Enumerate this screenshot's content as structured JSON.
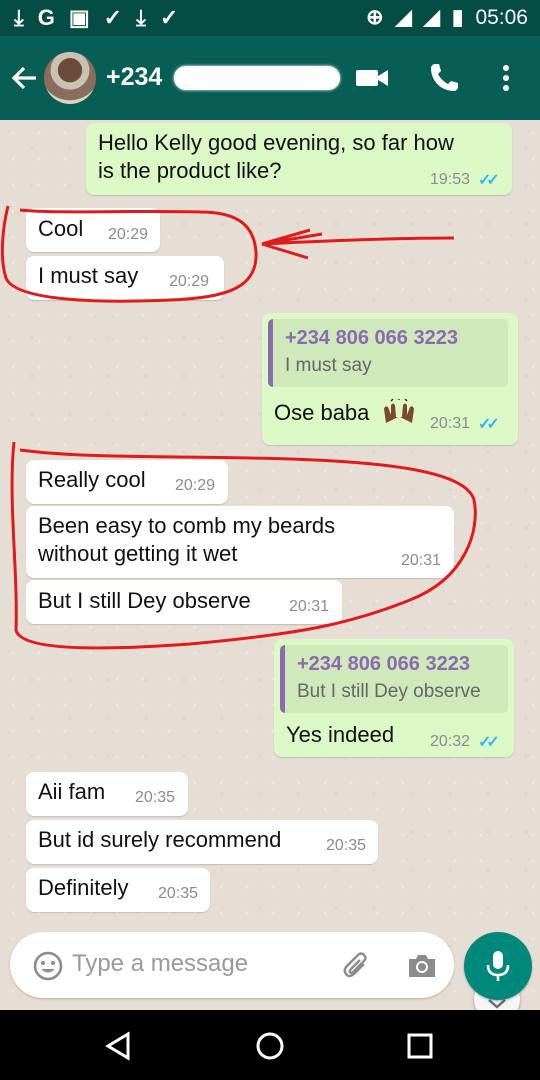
{
  "status_bar": {
    "time": "05:06",
    "left_icons": [
      "download-icon",
      "google-icon",
      "gallery-icon",
      "check-icon",
      "download-icon",
      "check-icon"
    ],
    "right_icons": [
      "data-saver-icon",
      "signal-icon",
      "signal-no-data-icon",
      "battery-icon"
    ]
  },
  "header": {
    "contact_name": "+234",
    "icons": [
      "back-arrow-icon",
      "avatar",
      "video-call-icon",
      "voice-call-icon",
      "more-options-icon"
    ],
    "color": "#075e54"
  },
  "messages": [
    {
      "dir": "out",
      "lines": [
        "Hello Kelly good evening, so far how",
        "is the product like?"
      ],
      "time": "19:53",
      "read": true
    },
    {
      "dir": "in",
      "lines": [
        "Cool"
      ],
      "time": "20:29"
    },
    {
      "dir": "in",
      "lines": [
        "I must say"
      ],
      "time": "20:29"
    },
    {
      "dir": "out",
      "quote_author": "+234 806 066 3223",
      "quote_text": "I must say",
      "lines": [
        "Ose baba"
      ],
      "emoji": "raising-hands-emoji",
      "time": "20:31",
      "read": true
    },
    {
      "dir": "in",
      "lines": [
        "Really cool"
      ],
      "time": "20:29"
    },
    {
      "dir": "in",
      "lines": [
        "Been easy to comb my beards",
        "without getting it wet"
      ],
      "time": "20:31"
    },
    {
      "dir": "in",
      "lines": [
        "But I still Dey observe"
      ],
      "time": "20:31"
    },
    {
      "dir": "out",
      "quote_author": "+234 806 066 3223",
      "quote_text": "But I still Dey observe",
      "lines": [
        "Yes indeed"
      ],
      "time": "20:32",
      "read": true
    },
    {
      "dir": "in",
      "lines": [
        "Aii fam"
      ],
      "time": "20:35"
    },
    {
      "dir": "in",
      "lines": [
        "But id surely recommend"
      ],
      "time": "20:35"
    },
    {
      "dir": "in",
      "lines": [
        "Definitely"
      ],
      "time": "20:35"
    }
  ],
  "composer": {
    "placeholder": "Type a message",
    "icons": [
      "emoji-icon",
      "attach-icon",
      "camera-icon",
      "mic-icon"
    ]
  },
  "colors": {
    "outgoing_bubble": "#dcf8c6",
    "incoming_bubble": "#ffffff",
    "accent": "#00897b",
    "read_ticks": "#34b7f1",
    "annotation": "#e01b1b"
  }
}
